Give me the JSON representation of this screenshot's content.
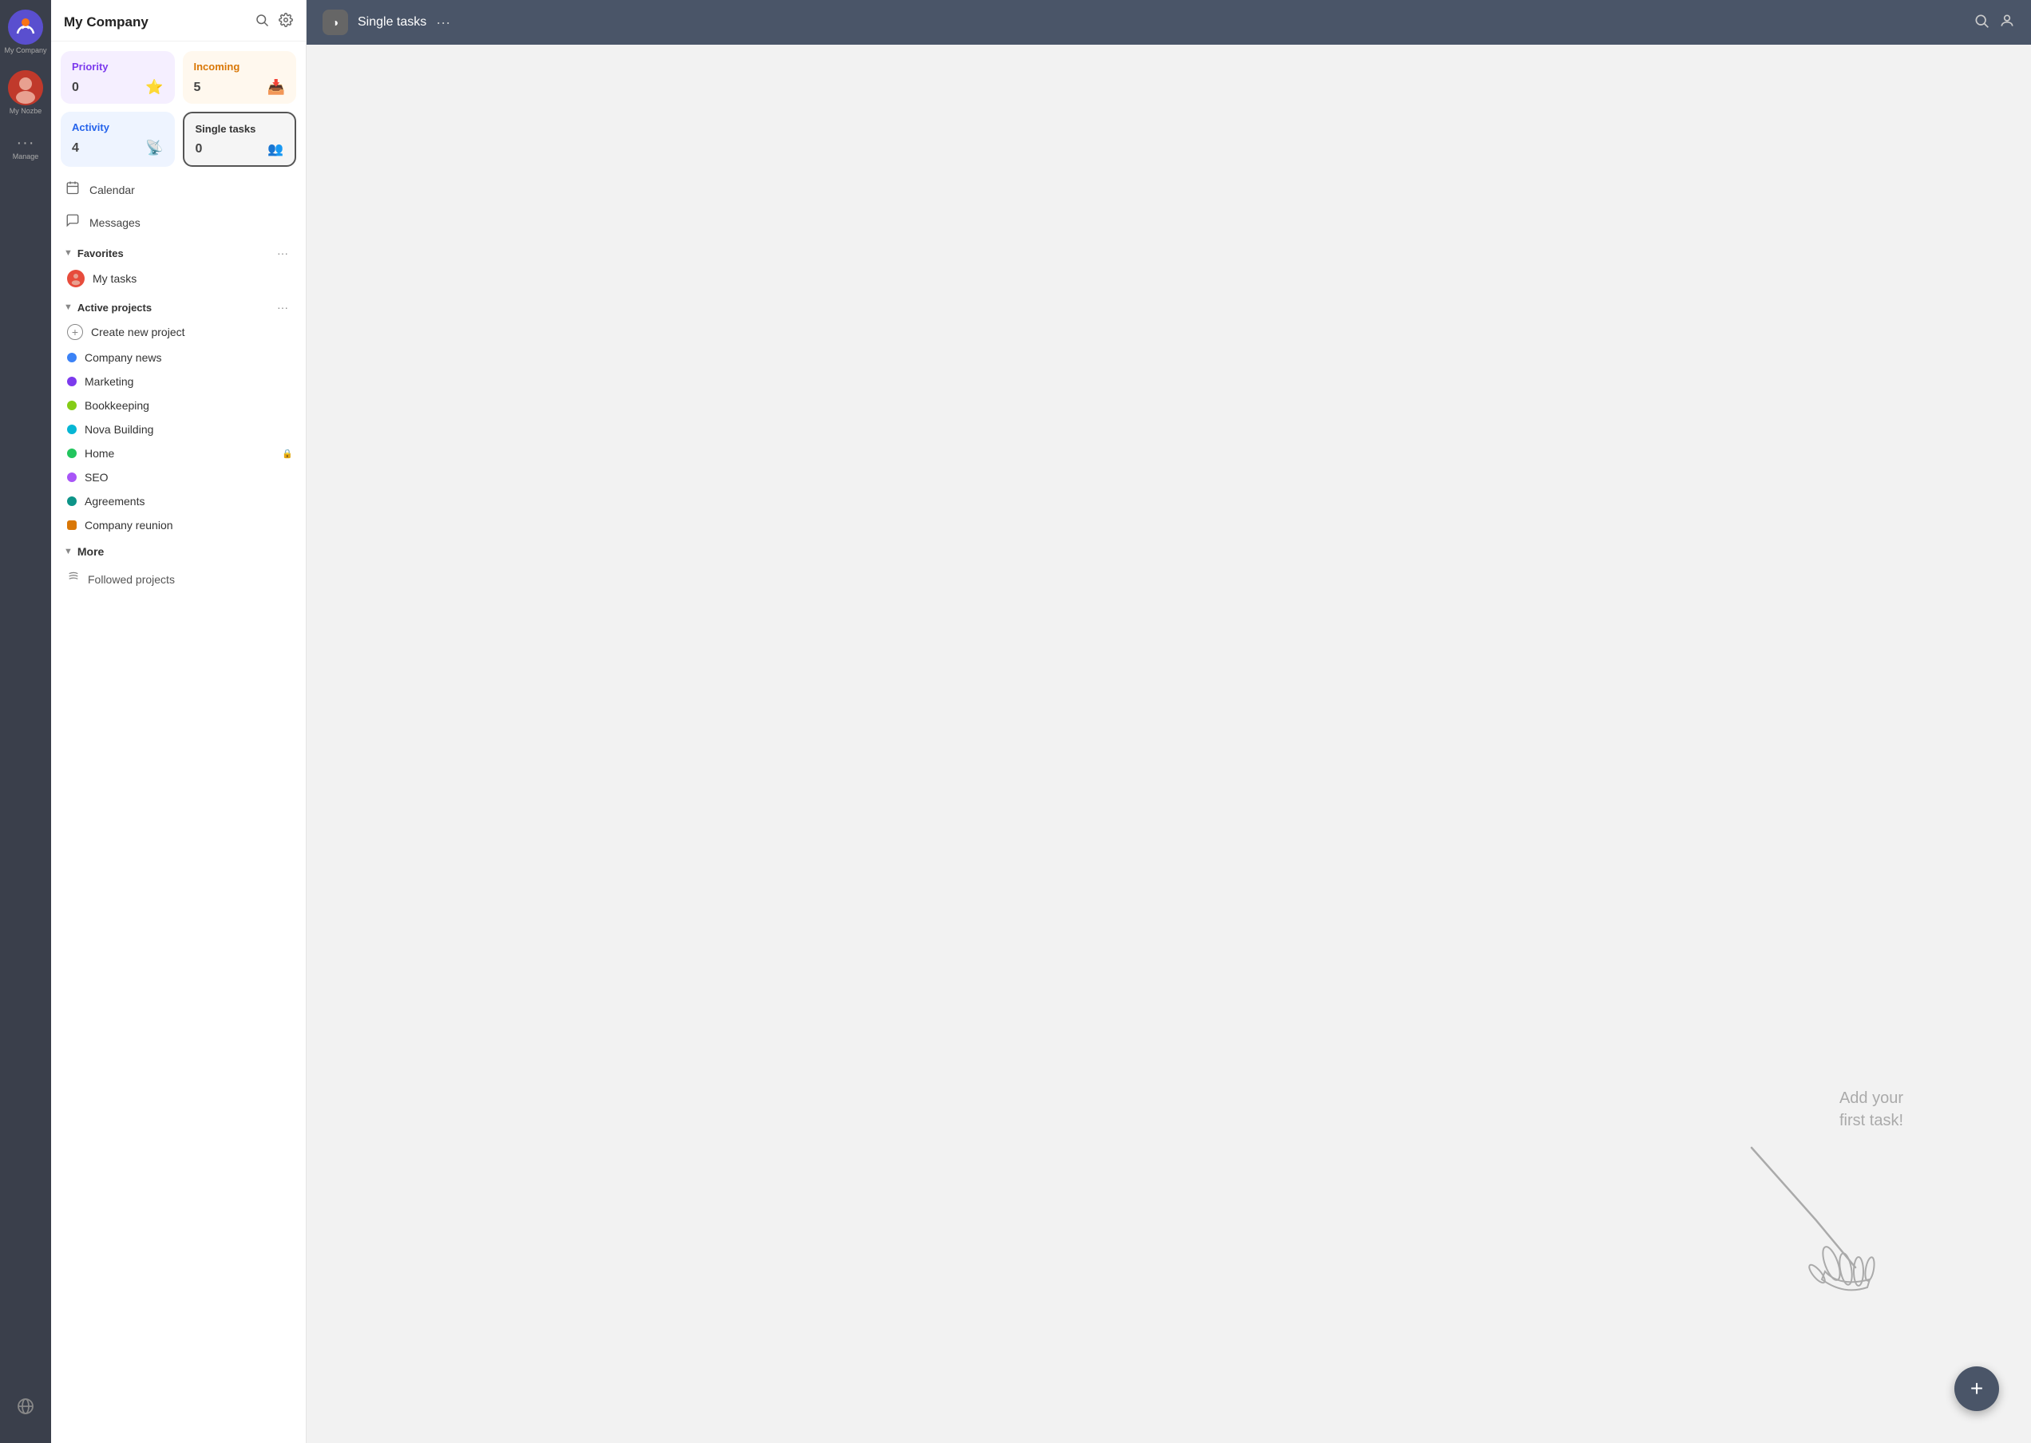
{
  "rail": {
    "company_label": "My Company",
    "user_label": "My Nozbe",
    "manage_label": "Manage"
  },
  "sidebar": {
    "title": "My Company",
    "search_tooltip": "Search",
    "settings_tooltip": "Settings",
    "cards": {
      "priority": {
        "title": "Priority",
        "count": "0",
        "icon": "⭐"
      },
      "incoming": {
        "title": "Incoming",
        "count": "5",
        "icon": "📥"
      },
      "activity": {
        "title": "Activity",
        "count": "4",
        "icon": "📡"
      },
      "single_tasks": {
        "title": "Single tasks",
        "count": "0",
        "icon": "👥"
      }
    },
    "nav": {
      "calendar": "Calendar",
      "messages": "Messages"
    },
    "favorites": {
      "label": "Favorites",
      "items": [
        {
          "name": "My tasks"
        }
      ]
    },
    "active_projects": {
      "label": "Active projects",
      "items": [
        {
          "name": "Create new project",
          "type": "create",
          "color": ""
        },
        {
          "name": "Company news",
          "type": "dot",
          "color": "#3b82f6"
        },
        {
          "name": "Marketing",
          "type": "dot",
          "color": "#7c3aed"
        },
        {
          "name": "Bookkeeping",
          "type": "dot",
          "color": "#84cc16"
        },
        {
          "name": "Nova Building",
          "type": "dot",
          "color": "#06b6d4"
        },
        {
          "name": "Home",
          "type": "dot",
          "color": "#22c55e",
          "lock": true
        },
        {
          "name": "SEO",
          "type": "dot",
          "color": "#a855f7"
        },
        {
          "name": "Agreements",
          "type": "dot",
          "color": "#0d9488"
        },
        {
          "name": "Company reunion",
          "type": "dot",
          "color": "#d97706"
        }
      ]
    },
    "more": {
      "label": "More",
      "items": [
        {
          "name": "Followed projects"
        }
      ]
    }
  },
  "main": {
    "header_icon": "◑",
    "title": "Single tasks",
    "empty_state_line1": "Add your",
    "empty_state_line2": "first task!",
    "fab_icon": "+"
  }
}
